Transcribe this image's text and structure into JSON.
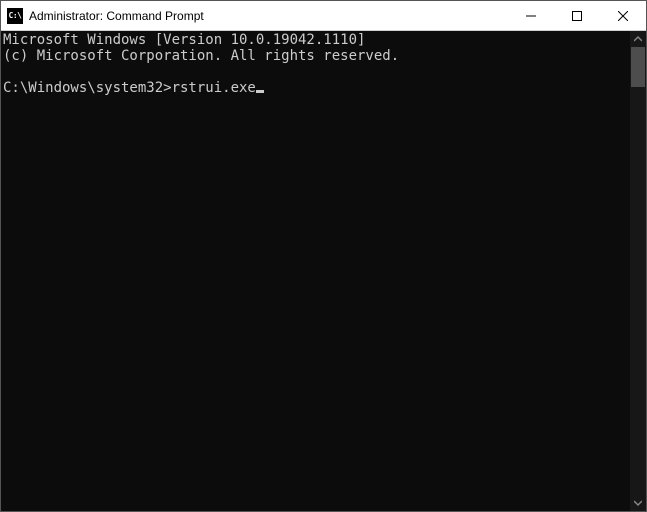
{
  "titlebar": {
    "icon_label": "C:\\",
    "title": "Administrator: Command Prompt"
  },
  "console": {
    "line1": "Microsoft Windows [Version 10.0.19042.1110]",
    "line2": "(c) Microsoft Corporation. All rights reserved.",
    "blank": "",
    "prompt": "C:\\Windows\\system32>",
    "command": "rstrui.exe"
  }
}
